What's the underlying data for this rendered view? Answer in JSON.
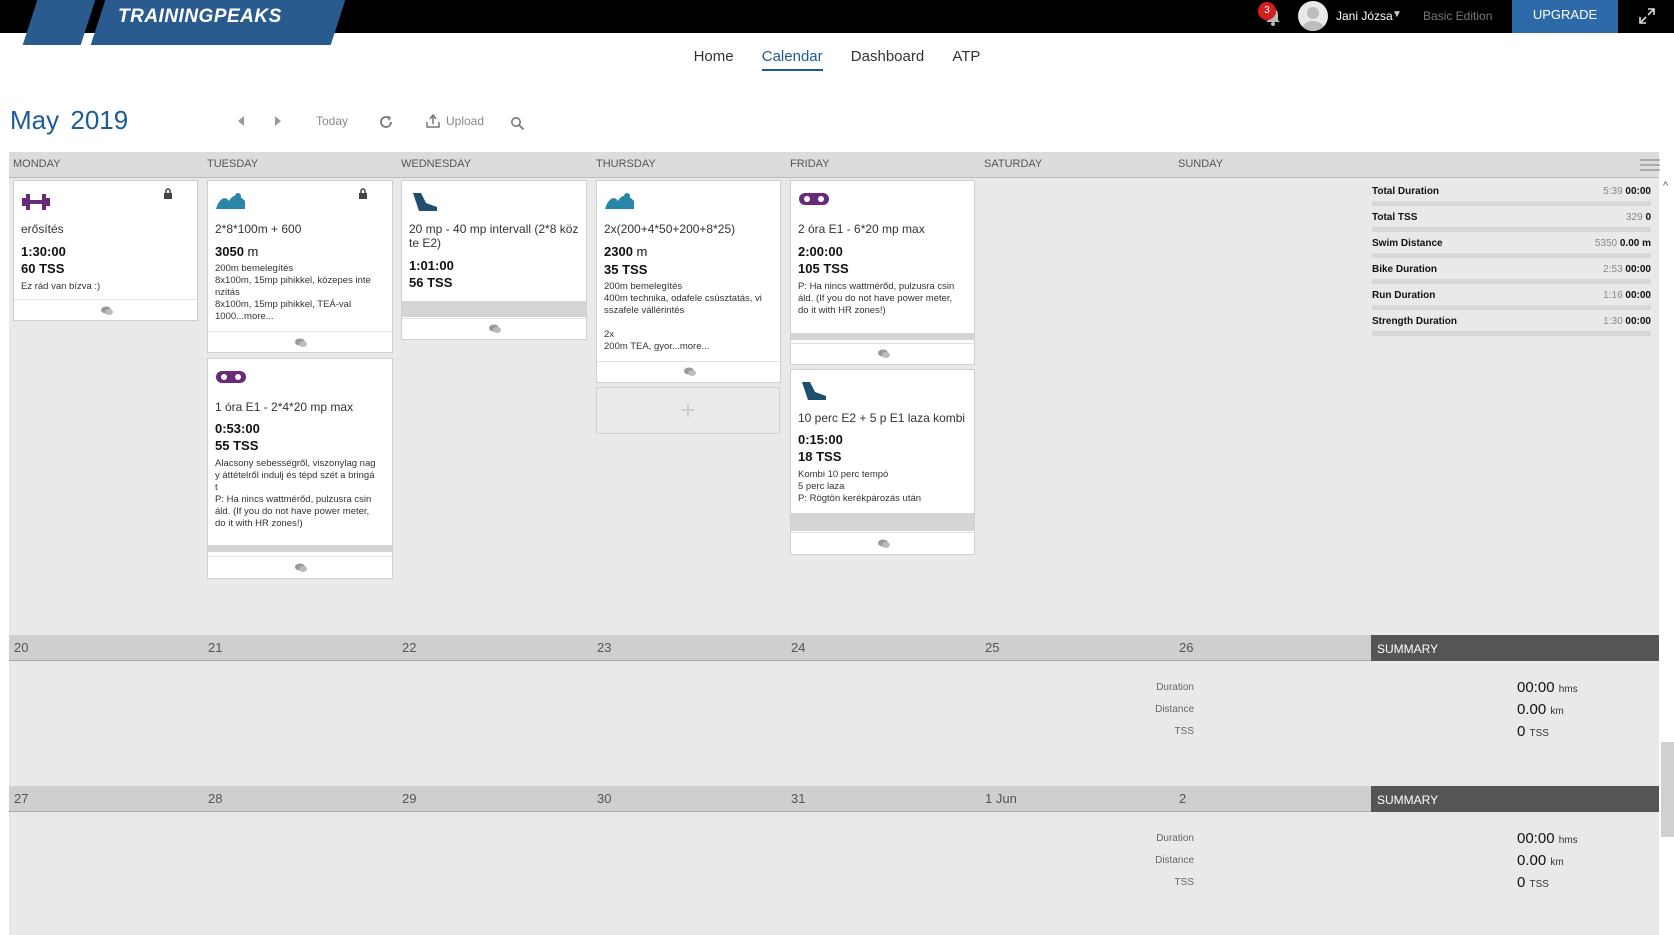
{
  "brand": {
    "name": "TRAININGPEAKS"
  },
  "header": {
    "notifications": "3",
    "user": "Jani Józsa",
    "edition": "Basic Edition",
    "upgrade": "UPGRADE"
  },
  "nav": {
    "items": [
      "Home",
      "Calendar",
      "Dashboard",
      "ATP"
    ],
    "active": "Calendar"
  },
  "calendar": {
    "month": "May",
    "year": "2019",
    "today": "Today",
    "upload": "Upload",
    "days": [
      "MONDAY",
      "TUESDAY",
      "WEDNESDAY",
      "THURSDAY",
      "FRIDAY",
      "SATURDAY",
      "SUNDAY"
    ]
  },
  "workouts": [
    {
      "day": "MONDAY",
      "sport": "strength",
      "locked": true,
      "title": "erősítés",
      "duration": "1:30:00",
      "tss": "60",
      "tss_unit": "TSS",
      "desc": "Ez rád van bízva :)"
    },
    {
      "day": "TUESDAY",
      "sport": "swim",
      "locked": true,
      "title": "2*8*100m + 600",
      "duration": "3050",
      "duration_unit": "m",
      "desc": "200m bemelegítés\n8x100m, 15mp pihikkel, közepes inte\nnzitás\n8x100m, 15mp pihikkel, TEÁ-val\n1000...more..."
    },
    {
      "day": "TUESDAY",
      "sport": "bike",
      "title": "1 óra E1 - 2*4*20 mp max",
      "duration": "0:53:00",
      "tss": "55",
      "tss_unit": "TSS",
      "desc": "Alacsony sebességről, viszonylag nag\ny áttételről indulj és tépd szét a bringá\nt\nP: Ha nincs wattmérőd, pulzusra csin\náld. (If you do not have power meter,\ndo it with HR zones!)"
    },
    {
      "day": "WEDNESDAY",
      "sport": "run",
      "title": "20 mp - 40 mp intervall (2*8 köz\nte E2)",
      "duration": "1:01:00",
      "tss": "56",
      "tss_unit": "TSS"
    },
    {
      "day": "THURSDAY",
      "sport": "swim",
      "title": "2x(200+4*50+200+8*25)",
      "duration": "2300",
      "duration_unit": "m",
      "tss": "35",
      "tss_unit": "TSS",
      "desc": "200m bemelegítés\n400m technika, odafele csúsztatás, vi\nsszafele vállérintés\n\n2x\n200m TEA, gyor...more..."
    },
    {
      "day": "FRIDAY",
      "sport": "bike",
      "title": "2 óra E1 - 6*20 mp max",
      "duration": "2:00:00",
      "tss": "105",
      "tss_unit": "TSS",
      "desc": "P: Ha nincs wattmérőd, pulzusra csin\náld. (If you do not have power meter,\ndo it with HR zones!)"
    },
    {
      "day": "FRIDAY",
      "sport": "run",
      "title": "10 perc E2 + 5 p E1 laza kombi",
      "duration": "0:15:00",
      "tss": "18",
      "tss_unit": "TSS",
      "desc": "Kombi 10 perc tempó\n5 perc laza\nP: Rögtön kerékpározás után"
    }
  ],
  "week_summary": [
    {
      "label": "Total Duration",
      "value": "5:39",
      "planned": "00:00"
    },
    {
      "label": "Total TSS",
      "value": "329",
      "planned": "0"
    },
    {
      "label": "Swim Distance",
      "value": "5350",
      "planned": "0.00 m"
    },
    {
      "label": "Bike Duration",
      "value": "2:53",
      "planned": "00:00"
    },
    {
      "label": "Run Duration",
      "value": "1:16",
      "planned": "00:00"
    },
    {
      "label": "Strength Duration",
      "value": "1:30",
      "planned": "00:00"
    }
  ],
  "weeks": [
    {
      "dates": [
        "20",
        "21",
        "22",
        "23",
        "24",
        "25",
        "26"
      ],
      "summary_label": "SUMMARY",
      "duration_label": "Duration",
      "duration": "00:00",
      "duration_unit": "hms",
      "distance_label": "Distance",
      "distance": "0.00",
      "distance_unit": "km",
      "tss_label": "TSS",
      "tss": "0",
      "tss_unit": "TSS"
    },
    {
      "dates": [
        "27",
        "28",
        "29",
        "30",
        "31",
        "1 Jun",
        "2"
      ],
      "summary_label": "SUMMARY",
      "duration_label": "Duration",
      "duration": "00:00",
      "duration_unit": "hms",
      "distance_label": "Distance",
      "distance": "0.00",
      "distance_unit": "km",
      "tss_label": "TSS",
      "tss": "0",
      "tss_unit": "TSS"
    }
  ],
  "colors": {
    "brand": "#2a5b8f",
    "accent": "#1e5b96",
    "upgrade": "#2e6aa9",
    "swim": "#2a86a8",
    "bike": "#6a2a7a",
    "strength": "#6a2a7a",
    "run": "#1f4e6e"
  }
}
